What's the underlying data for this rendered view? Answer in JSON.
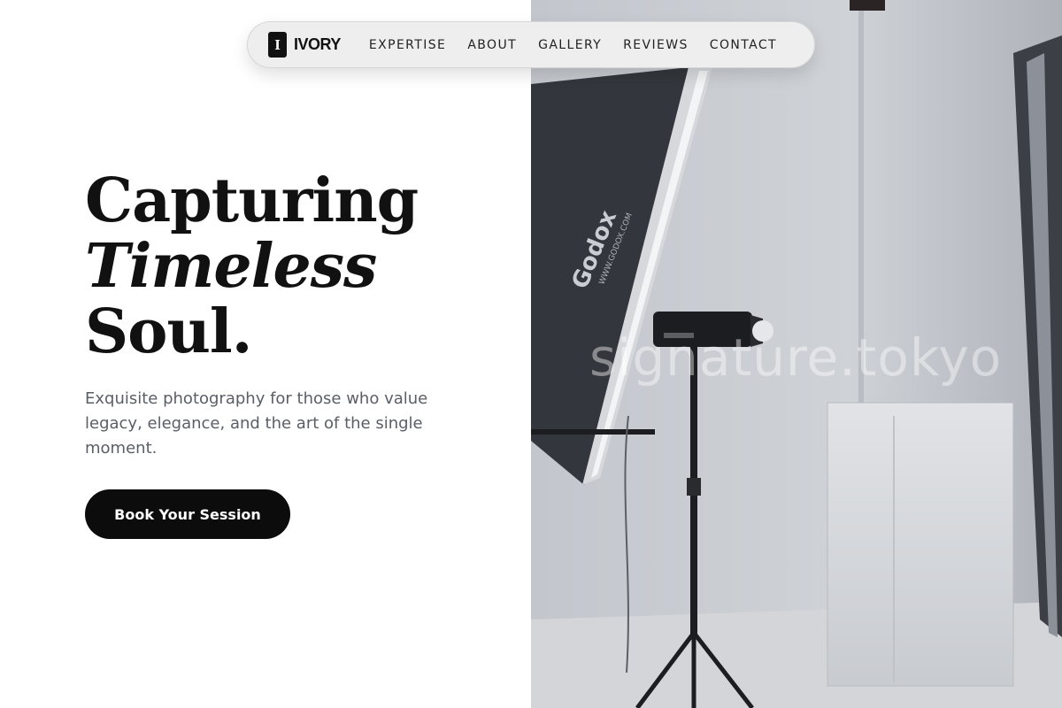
{
  "brand": {
    "mark": "I",
    "name": "IVORY"
  },
  "nav": {
    "links": [
      "EXPERTISE",
      "ABOUT",
      "GALLERY",
      "REVIEWS",
      "CONTACT"
    ]
  },
  "hero": {
    "title_line1": "Capturing",
    "title_line2": "Timeless",
    "title_line3": "Soul.",
    "subtitle": "Exquisite photography for those who value legacy, elegance, and the art of the single moment.",
    "cta_label": "Book Your Session"
  },
  "photo": {
    "softbox_brand": "Godox",
    "softbox_url": "WWW.GODOX.COM",
    "watermark": "signature.tokyo"
  },
  "colors": {
    "accent": "#0c0c0c",
    "background": "#ffffff",
    "subtitle": "#5b5e66"
  }
}
